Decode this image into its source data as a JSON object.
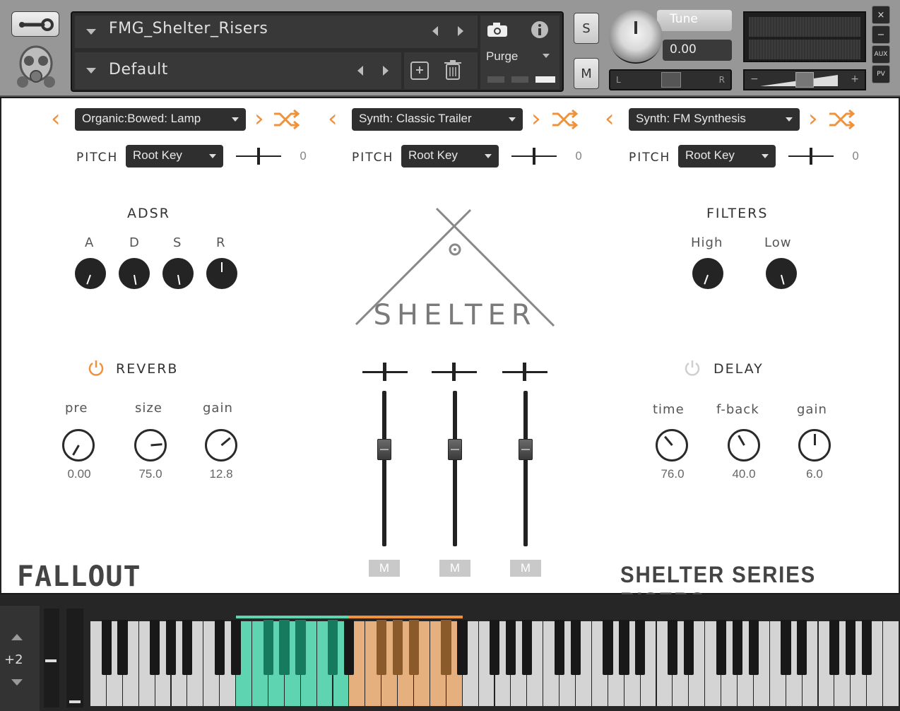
{
  "header": {
    "instrument_name": "FMG_Shelter_Risers",
    "snapshot_name": "Default",
    "purge_label": "Purge",
    "solo_label": "S",
    "mute_label": "M",
    "tune_label": "Tune",
    "tune_value": "0.00",
    "pan_left": "L",
    "pan_right": "R",
    "aux_label": "AUX",
    "pv_label": "PV",
    "close_label": "×",
    "minimize_label": "−"
  },
  "layers": [
    {
      "preset": "Organic:Bowed: Lamp",
      "pitch_label": "PITCH",
      "pitch_mode": "Root Key",
      "pitch_value": "0"
    },
    {
      "preset": "Synth: Classic Trailer",
      "pitch_label": "PITCH",
      "pitch_mode": "Root Key",
      "pitch_value": "0"
    },
    {
      "preset": "Synth: FM Synthesis",
      "pitch_label": "PITCH",
      "pitch_mode": "Root Key",
      "pitch_value": "0"
    }
  ],
  "adsr": {
    "title": "ADSR",
    "knobs": [
      {
        "label": "A",
        "level": 0.15
      },
      {
        "label": "D",
        "level": 0.3
      },
      {
        "label": "S",
        "level": 0.3
      },
      {
        "label": "R",
        "level": 0.5
      }
    ]
  },
  "filters": {
    "title": "FILTERS",
    "knobs": [
      {
        "label": "High",
        "level": 0.15
      },
      {
        "label": "Low",
        "level": 0.35
      }
    ]
  },
  "logo": {
    "name": "SHELTER"
  },
  "reverb": {
    "title": "REVERB",
    "enabled": true,
    "knobs": [
      {
        "label": "pre",
        "value": "0.00"
      },
      {
        "label": "size",
        "value": "75.0"
      },
      {
        "label": "gain",
        "value": "12.8"
      }
    ]
  },
  "delay": {
    "title": "DELAY",
    "enabled": false,
    "knobs": [
      {
        "label": "time",
        "value": "76.0"
      },
      {
        "label": "f-back",
        "value": "40.0"
      },
      {
        "label": "gain",
        "value": "6.0"
      }
    ]
  },
  "mixer": {
    "mute_labels": [
      "M",
      "M",
      "M"
    ],
    "fader_levels": [
      0.65,
      0.65,
      0.65
    ]
  },
  "footer": {
    "brand": "FALLOUT",
    "series": "SHELTER SERIES RISERS"
  },
  "keyboard": {
    "octave": "+2",
    "zone1_color": "#5fd4b0",
    "zone2_color": "#e5b07e",
    "accent_color": "#f0923c"
  }
}
